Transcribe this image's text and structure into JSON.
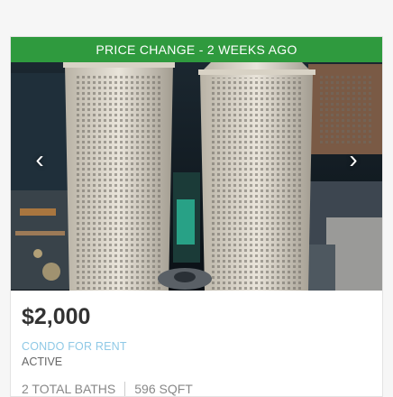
{
  "listing": {
    "banner": "PRICE CHANGE - 2 WEEKS AGO",
    "price": "$2,000",
    "property_type": "CONDO FOR RENT",
    "status": "ACTIVE",
    "baths": "2 TOTAL BATHS",
    "size": "596 SQFT",
    "prev_arrow": "‹",
    "next_arrow": "›"
  },
  "colors": {
    "banner": "#2f9a3e",
    "price": "#333333",
    "property_type": "#8fc9e6",
    "status": "#666666"
  },
  "icons": [
    "chevron-left-icon",
    "chevron-right-icon"
  ]
}
